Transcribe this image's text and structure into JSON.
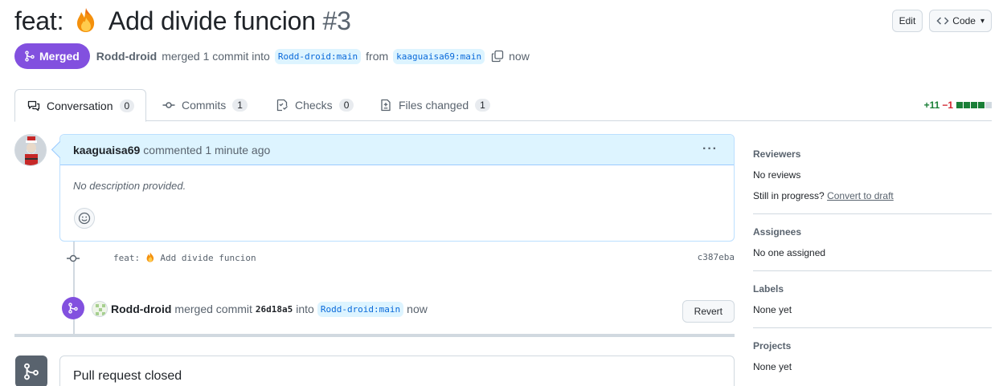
{
  "header": {
    "title": "feat:",
    "title_rest": "Add divide funcion",
    "number": "#3",
    "edit_label": "Edit",
    "code_label": "Code"
  },
  "state": {
    "badge": "Merged",
    "author": "Rodd-droid",
    "merged_text": "merged 1 commit into",
    "base_branch": "Rodd-droid:main",
    "from_text": "from",
    "head_branch": "kaaguaisa69:main",
    "time": "now"
  },
  "tabs": [
    {
      "label": "Conversation",
      "count": "0"
    },
    {
      "label": "Commits",
      "count": "1"
    },
    {
      "label": "Checks",
      "count": "0"
    },
    {
      "label": "Files changed",
      "count": "1"
    }
  ],
  "diffstat": {
    "additions": "+11",
    "deletions": "−1"
  },
  "comment": {
    "author": "kaaguaisa69",
    "meta": "commented 1 minute ago",
    "body": "No description provided."
  },
  "commit": {
    "message_prefix": "feat:",
    "message_rest": "Add divide funcion",
    "sha": "c387eba"
  },
  "merge_event": {
    "author": "Rodd-droid",
    "text": "merged commit",
    "sha": "26d18a5",
    "into": "into",
    "branch": "Rodd-droid:main",
    "time": "now",
    "revert_label": "Revert"
  },
  "closed": {
    "title": "Pull request closed"
  },
  "sidebar": {
    "reviewers_title": "Reviewers",
    "reviewers_value": "No reviews",
    "progress_text": "Still in progress?",
    "convert_link": "Convert to draft",
    "assignees_title": "Assignees",
    "assignees_value": "No one assigned",
    "labels_title": "Labels",
    "labels_value": "None yet",
    "projects_title": "Projects",
    "projects_value": "None yet"
  },
  "colors": {
    "merged": "#8250df",
    "link": "#0969da",
    "branch_bg": "#ddf4ff",
    "add": "#1a7f37",
    "del": "#d1242f"
  }
}
